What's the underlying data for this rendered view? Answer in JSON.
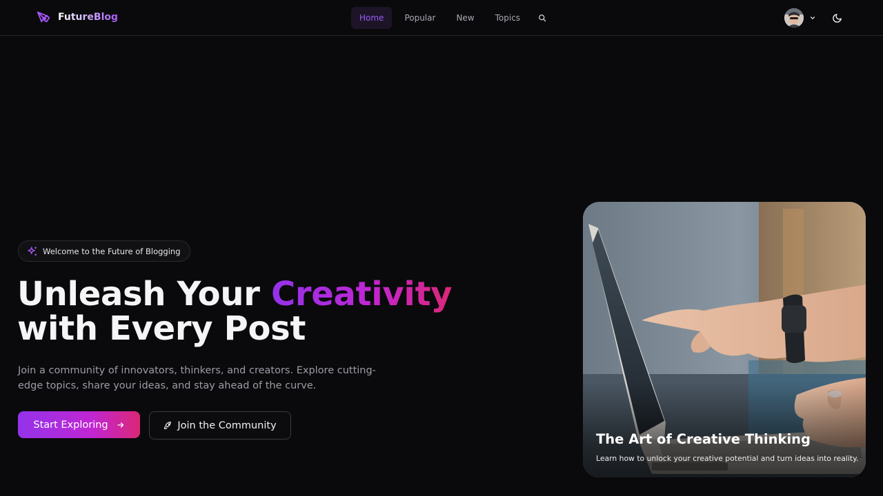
{
  "header": {
    "brand_name": "FutureBlog",
    "nav": [
      {
        "label": "Home",
        "active": true
      },
      {
        "label": "Popular",
        "active": false
      },
      {
        "label": "New",
        "active": false
      },
      {
        "label": "Topics",
        "active": false
      }
    ],
    "icons": {
      "brand": "pen-nib-icon",
      "search": "search-icon",
      "user_menu": "chevron-down-icon",
      "theme": "moon-icon"
    }
  },
  "hero": {
    "badge_text": "Welcome to the Future of Blogging",
    "headline_start": "Unleash Your ",
    "headline_accent": "Creativity",
    "headline_end": "with Every Post",
    "subtext": "Join a community of innovators, thinkers, and creators. Explore cutting-edge topics, share your ideas, and stay ahead of the curve.",
    "primary_button": "Start Exploring",
    "secondary_button": "Join the Community"
  },
  "featured": {
    "title": "The Art of Creative Thinking",
    "description": "Learn how to unlock your creative potential and turn ideas into reality."
  },
  "colors": {
    "background": "#0a0a0c",
    "accent_purple": "#9333ea",
    "accent_pink": "#db2777",
    "nav_active_bg": "#1d1428",
    "nav_active_text": "#9b5cf6"
  }
}
